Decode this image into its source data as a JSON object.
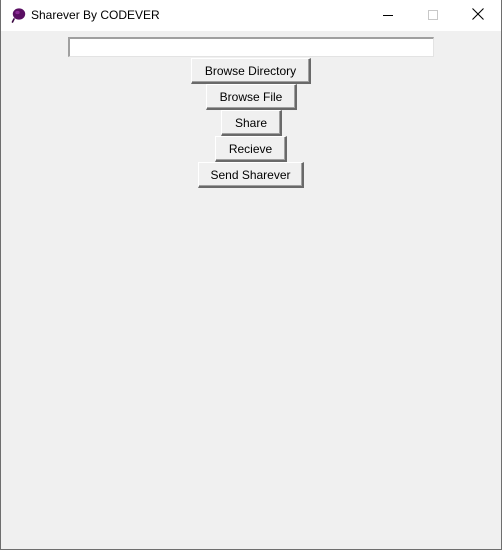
{
  "window": {
    "title": "Sharever By CODEVER",
    "icon": "purple-feather-icon",
    "controls": {
      "minimize_icon": "minimize-icon",
      "maximize_icon": "maximize-icon",
      "close_icon": "close-icon"
    }
  },
  "form": {
    "path_value": "",
    "path_placeholder": "",
    "buttons": {
      "browse_directory": "Browse Directory",
      "browse_file": "Browse File",
      "share": "Share",
      "recieve": "Recieve",
      "send_sharever": "Send Sharever"
    }
  },
  "colors": {
    "background": "#f0f0f0",
    "titlebar": "#ffffff",
    "icon_accent": "#5a0f63"
  }
}
